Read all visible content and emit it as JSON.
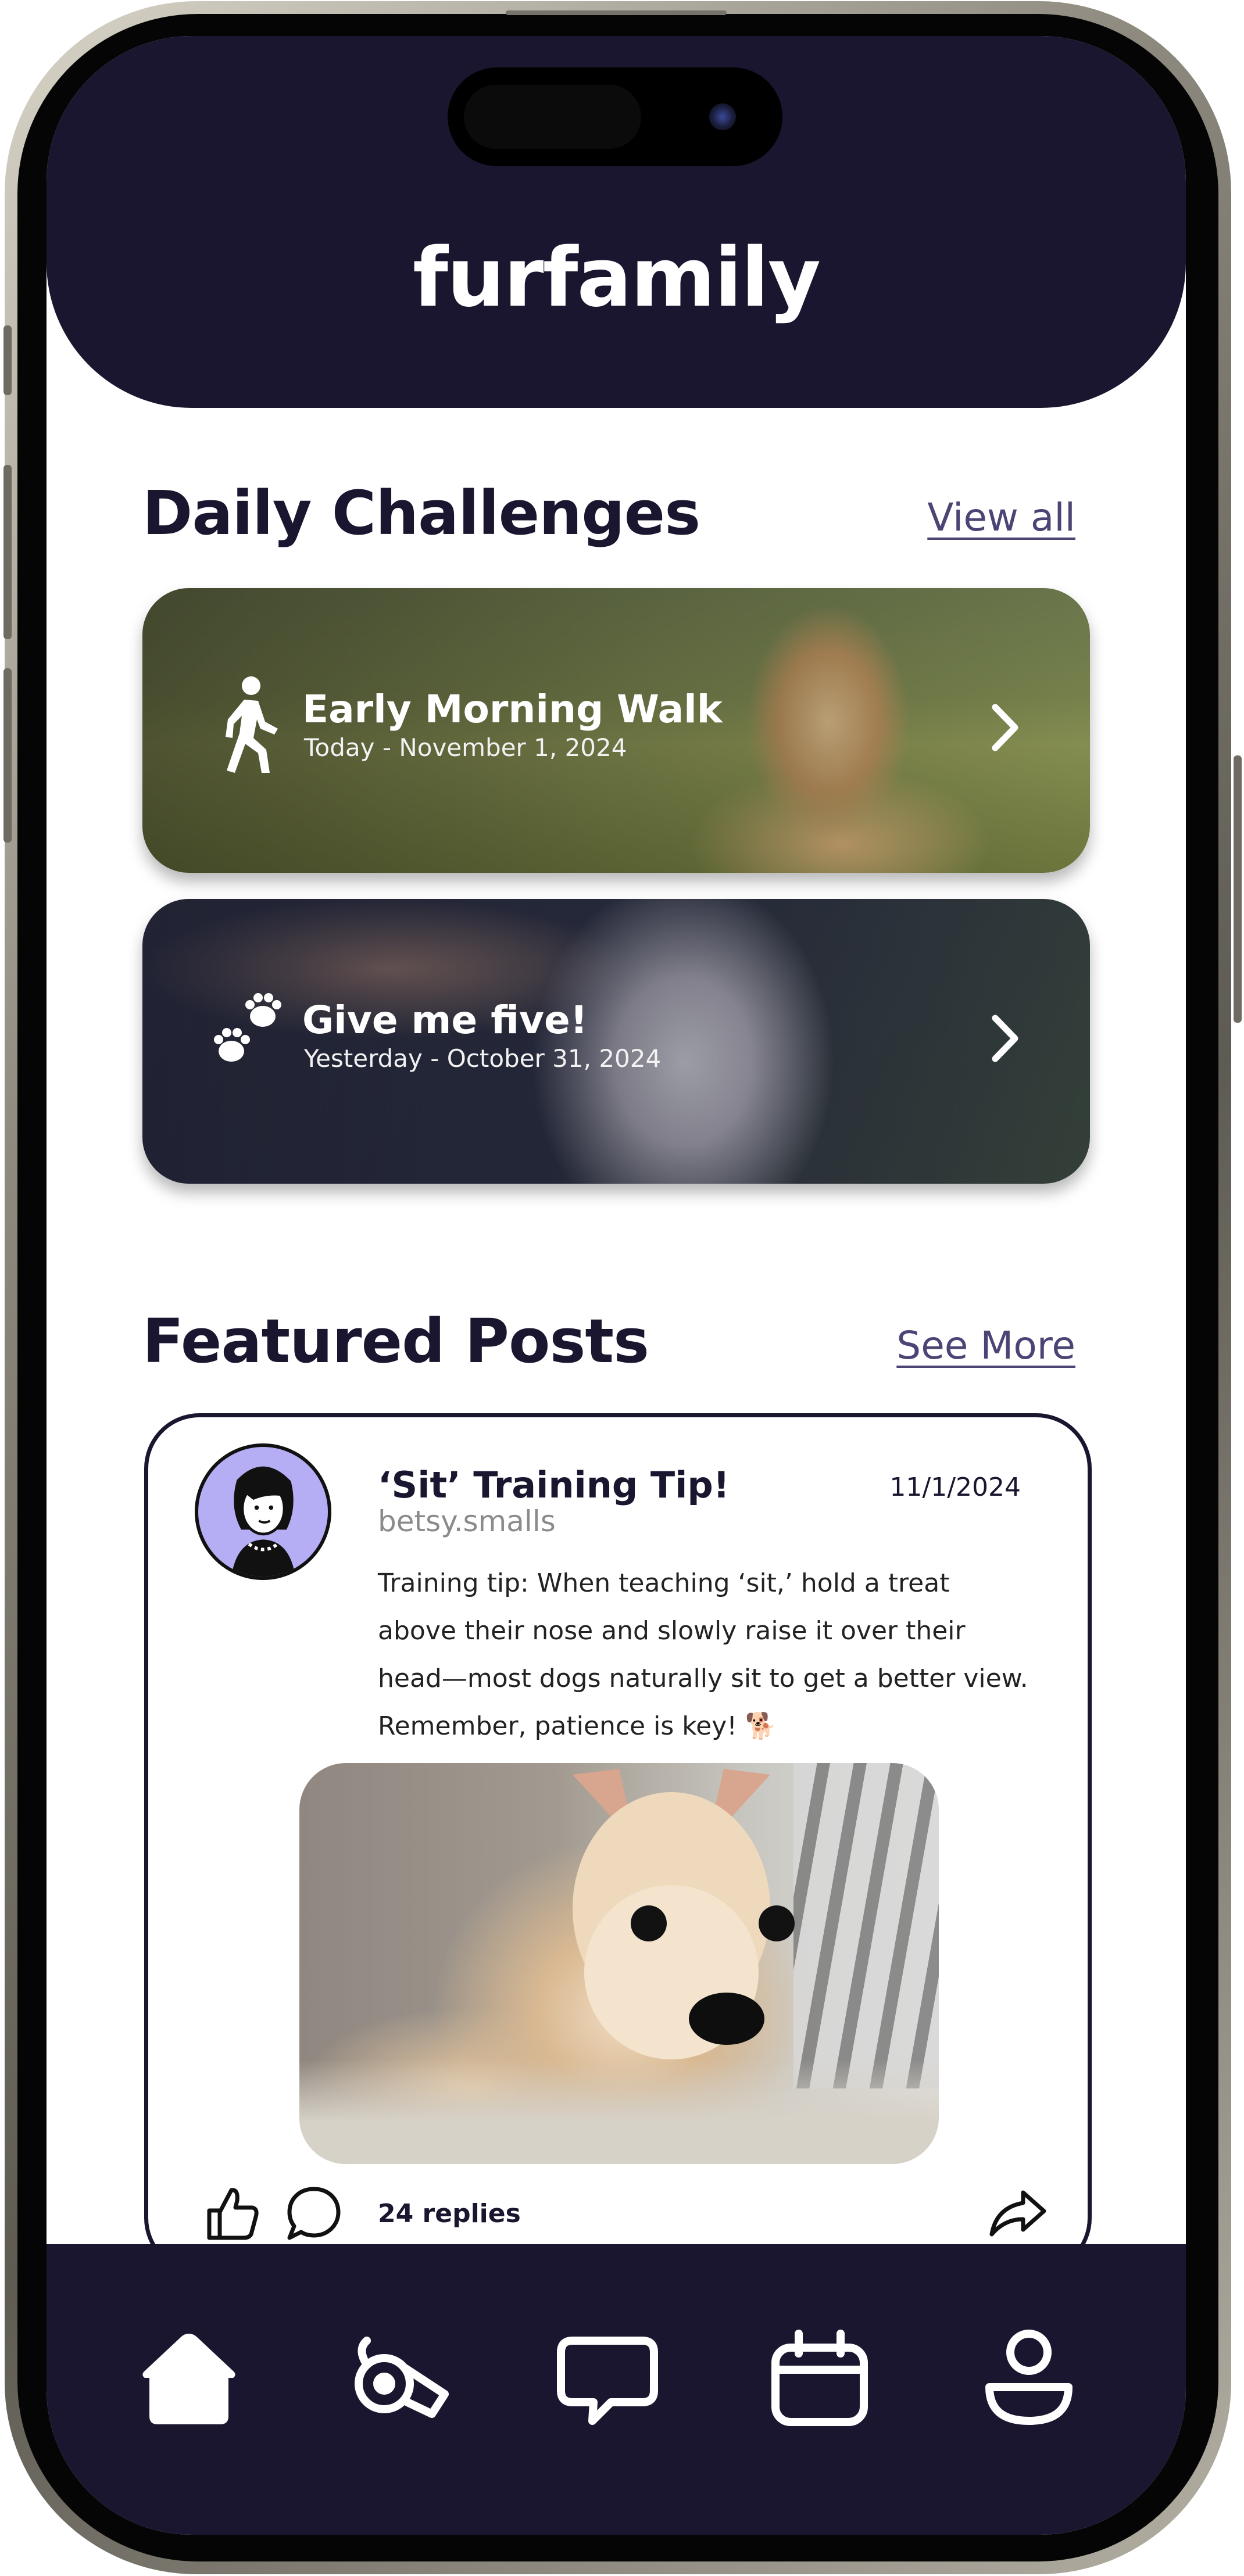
{
  "app": {
    "title": "furfamily"
  },
  "challenges": {
    "heading": "Daily Challenges",
    "view_all": "View all",
    "items": [
      {
        "title": "Early Morning Walk",
        "date": "Today - November 1, 2024",
        "icon": "walking-person-icon"
      },
      {
        "title": "Give me five!",
        "date": "Yesterday - October 31, 2024",
        "icon": "paw-prints-icon"
      }
    ]
  },
  "featured": {
    "heading": "Featured Posts",
    "see_more": "See More",
    "post": {
      "title": "‘Sit’ Training Tip!",
      "date": "11/1/2024",
      "author": "betsy.smalls",
      "body": "Training tip: When teaching ‘sit,’ hold a treat above their nose and slowly raise it over their head—most dogs naturally sit to get a better view. Remember, patience is key! 🐕",
      "replies": "24 replies"
    }
  },
  "tabbar": {
    "items": [
      {
        "name": "home",
        "icon": "home-icon",
        "active": true
      },
      {
        "name": "training",
        "icon": "whistle-icon"
      },
      {
        "name": "chat",
        "icon": "chat-bubble-icon"
      },
      {
        "name": "calendar",
        "icon": "calendar-icon"
      },
      {
        "name": "profile",
        "icon": "profile-icon"
      }
    ]
  },
  "colors": {
    "navy": "#1a1630",
    "link": "#4a4574",
    "avatar_bg": "#b5aef5"
  }
}
